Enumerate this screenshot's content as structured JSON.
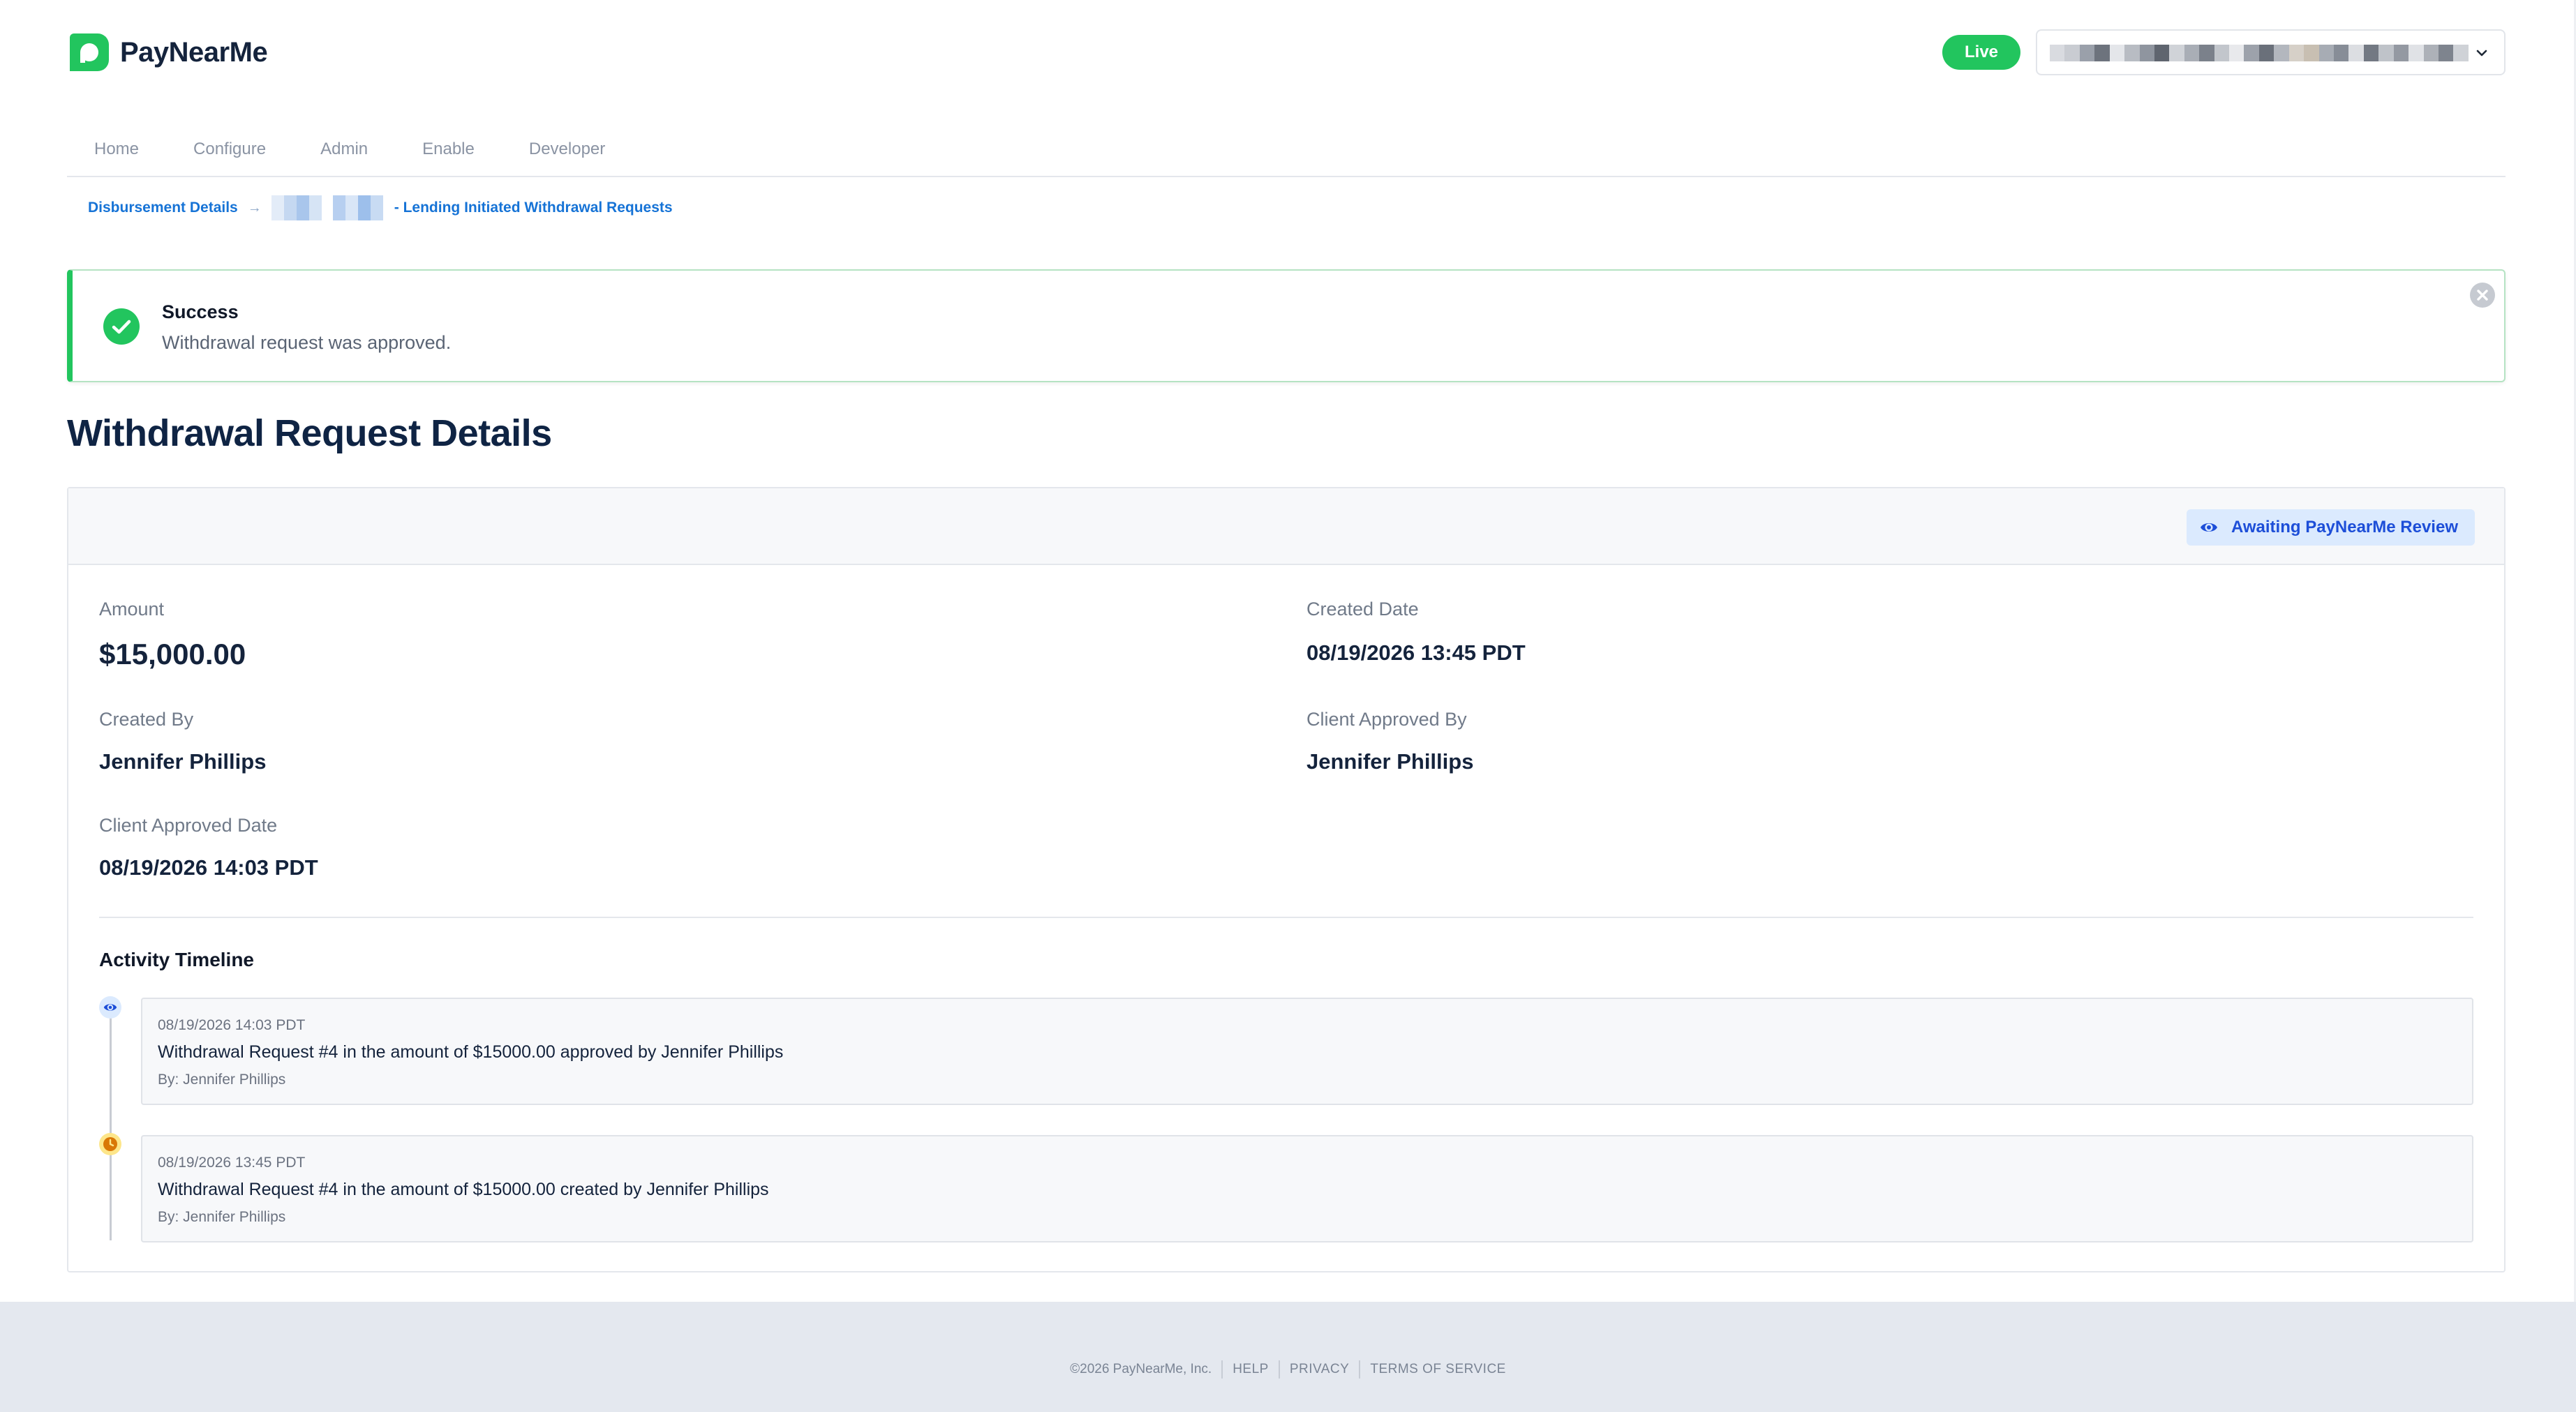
{
  "brand": {
    "name": "PayNearMe",
    "accent": "#22c55e",
    "link_color": "#1673d6"
  },
  "header": {
    "env_badge": "Live",
    "account_select": {
      "value_redacted": true,
      "icon": "chevron-down-icon"
    }
  },
  "nav": {
    "items": [
      {
        "label": "Home"
      },
      {
        "label": "Configure"
      },
      {
        "label": "Admin"
      },
      {
        "label": "Enable"
      },
      {
        "label": "Developer"
      }
    ]
  },
  "breadcrumb": {
    "first": "Disbursement Details",
    "separator": "→",
    "last": "- Lending Initiated Withdrawal Requests"
  },
  "alert": {
    "type": "success",
    "title": "Success",
    "message": "Withdrawal request was approved.",
    "icon": "check-circle-icon",
    "close_icon": "close-icon"
  },
  "page": {
    "title": "Withdrawal Request Details"
  },
  "status": {
    "label": "Awaiting PayNearMe Review",
    "icon": "eye-icon",
    "color": "#1d4ed8"
  },
  "details": {
    "amount_label": "Amount",
    "amount_value": "$15,000.00",
    "created_date_label": "Created Date",
    "created_date_value": "08/19/2026 13:45 PDT",
    "created_by_label": "Created By",
    "created_by_value": "Jennifer Phillips",
    "client_approved_by_label": "Client Approved By",
    "client_approved_by_value": "Jennifer Phillips",
    "client_approved_date_label": "Client Approved Date",
    "client_approved_date_value": "08/19/2026 14:03 PDT"
  },
  "timeline": {
    "title": "Activity Timeline",
    "entries": [
      {
        "icon": "eye-icon",
        "time": "08/19/2026 14:03 PDT",
        "text": "Withdrawal Request #4 in the amount of $15000.00 approved by Jennifer Phillips",
        "by": "By: Jennifer Phillips"
      },
      {
        "icon": "clock-icon",
        "time": "08/19/2026 13:45 PDT",
        "text": "Withdrawal Request #4 in the amount of $15000.00 created by Jennifer Phillips",
        "by": "By: Jennifer Phillips"
      }
    ]
  },
  "footer": {
    "copyright": "©2026 PayNearMe, Inc.",
    "links": [
      "HELP",
      "PRIVACY",
      "TERMS OF SERVICE"
    ]
  }
}
